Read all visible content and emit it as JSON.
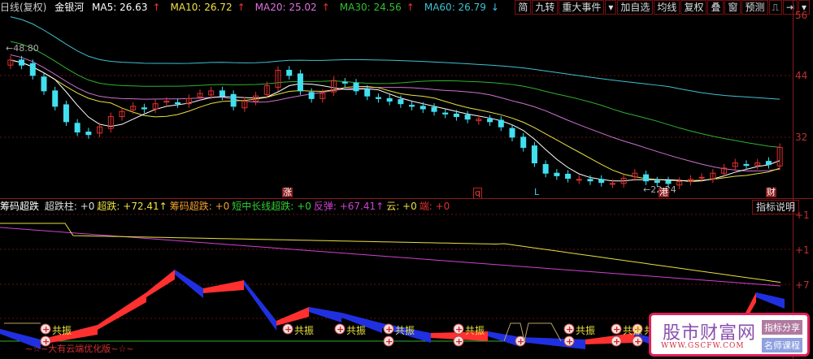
{
  "header": {
    "period": "日线(复权)",
    "stock": "金银河",
    "ma": [
      {
        "label": "MA5: 26.63",
        "arrow": "↑",
        "color": "#ffffff"
      },
      {
        "label": "MA10: 26.72",
        "arrow": "↑",
        "color": "#f0e040"
      },
      {
        "label": "MA20: 25.02",
        "arrow": "↑",
        "color": "#e070e0"
      },
      {
        "label": "MA30: 24.56",
        "arrow": "↑",
        "color": "#30c030"
      },
      {
        "label": "MA60: 26.79",
        "arrow": "↓",
        "color": "#40c0d0"
      }
    ]
  },
  "toolbar": {
    "items": [
      "简",
      "九转",
      "重大事件",
      "▾",
      "加自选",
      "均线",
      "复权",
      "叠",
      "窗",
      "预测",
      "⎍",
      "⇥",
      "▾"
    ]
  },
  "price_axis": {
    "labels": [
      "56",
      "44",
      "32"
    ]
  },
  "price_annotations": {
    "high": "48.80",
    "low": "22.24"
  },
  "event_marks": [
    "涨",
    "q",
    "L",
    "港",
    "财"
  ],
  "indicator": {
    "name": "筹码超跌",
    "items": [
      {
        "label": "超跌柱: +0",
        "color": "#dddddd"
      },
      {
        "label": "超跌: +72.41↑",
        "color": "#f0e040"
      },
      {
        "label": "筹码超跌: +0",
        "color": "#f0a030"
      },
      {
        "label": "短中长线超跌: +0",
        "color": "#30d030"
      },
      {
        "label": "反弹: +67.41↑",
        "color": "#d040d0"
      },
      {
        "label": "云: +0",
        "color": "#f0e040"
      },
      {
        "label": "端: +0",
        "color": "#e03030"
      }
    ],
    "help_button": "指标说明",
    "axis_labels": [
      "+1",
      "+1",
      "+7"
    ],
    "resonance_label": "共振",
    "footer": "~☆~大有云端优化版~☆~"
  },
  "ad": {
    "title": "股市财富网",
    "url": "WWW.GSCFW.COM",
    "btn1": "指标分享",
    "btn2": "名师课程"
  },
  "chart_data": {
    "type": "candlestick",
    "closes": [
      47,
      46,
      44,
      41,
      38,
      35,
      33,
      32.5,
      34,
      36,
      37,
      38,
      37.5,
      38.5,
      39,
      38.5,
      39.5,
      40.5,
      41,
      40,
      38,
      39,
      40,
      42,
      45,
      44,
      41,
      39.5,
      40.5,
      43,
      42.5,
      41,
      40,
      39.5,
      39,
      38.5,
      38,
      37.5,
      37,
      36.5,
      36,
      35.5,
      35.5,
      35,
      34,
      32,
      30,
      27,
      25,
      24.5,
      24,
      23.8,
      23.5,
      23.2,
      23,
      24,
      25,
      23.5,
      23.2,
      23,
      23.4,
      23.8,
      24.2,
      25,
      26,
      27,
      26.5,
      27,
      26.7,
      30
    ],
    "ylim": [
      20.3,
      55.5
    ]
  }
}
